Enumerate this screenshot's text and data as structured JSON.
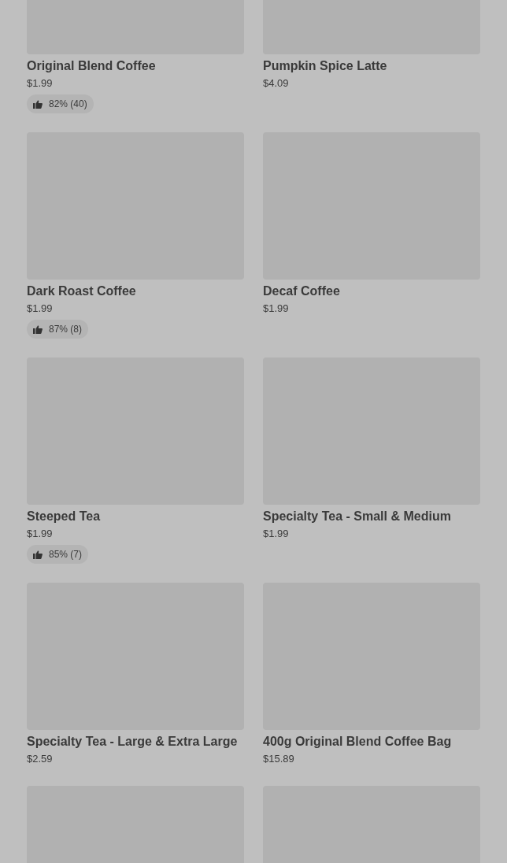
{
  "products": [
    {
      "kind": "product",
      "name": "Original Blend Coffee",
      "price": "$1.99",
      "rating": "82% (40)"
    },
    {
      "kind": "product",
      "name": "Pumpkin Spice Latte",
      "price": "$4.09"
    },
    {
      "kind": "product",
      "name": "Dark Roast Coffee",
      "price": "$1.99",
      "rating": "87% (8)"
    },
    {
      "kind": "product",
      "name": "Decaf Coffee",
      "price": "$1.99"
    },
    {
      "kind": "product",
      "name": "Steeped Tea",
      "price": "$1.99",
      "rating": "85% (7)"
    },
    {
      "kind": "product",
      "name": "Specialty Tea - Small & Medium",
      "price": "$1.99"
    },
    {
      "kind": "product",
      "name": "Specialty Tea - Large & Extra Large",
      "price": "$2.59"
    },
    {
      "kind": "product",
      "name": "400g Original Blend Coffee Bag",
      "price": "$15.89"
    },
    {
      "kind": "picture"
    },
    {
      "kind": "picture"
    }
  ]
}
